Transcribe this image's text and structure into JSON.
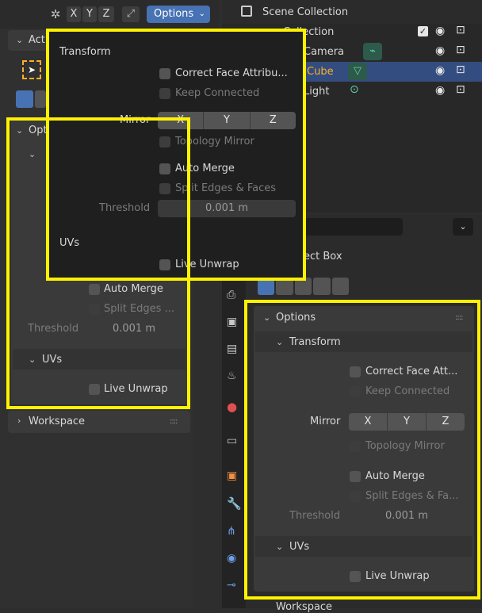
{
  "header": {
    "axis_buttons": [
      "X",
      "Y",
      "Z"
    ],
    "options_label": "Options"
  },
  "outliner": {
    "title": "Scene Collection",
    "rows": [
      {
        "label": "Collection"
      },
      {
        "label": "Camera"
      },
      {
        "label": "Cube"
      },
      {
        "label": "Light"
      }
    ]
  },
  "popup": {
    "transform_heading": "Transform",
    "correct_face": "Correct Face Attribu...",
    "keep_connected": "Keep Connected",
    "mirror_label": "Mirror",
    "mirror_axes": [
      "X",
      "Y",
      "Z"
    ],
    "topology_mirror": "Topology Mirror",
    "auto_merge": "Auto Merge",
    "split_edges": "Split Edges & Faces",
    "threshold_label": "Threshold",
    "threshold_value": "0.001 m",
    "uvs_heading": "UVs",
    "live_unwrap": "Live Unwrap"
  },
  "left_panel": {
    "active_tab": "Acti",
    "options_title": "Opti",
    "auto_merge": "Auto Merge",
    "split_edges": "Split Edges ...",
    "threshold_label": "Threshold",
    "threshold_value": "0.001 m",
    "uvs": "UVs",
    "live_unwrap": "Live Unwrap",
    "workspace": "Workspace"
  },
  "right_panel": {
    "tool_name": "ect Box",
    "options_title": "Options",
    "transform": "Transform",
    "correct_face": "Correct Face Att...",
    "keep_connected": "Keep Connected",
    "mirror_label": "Mirror",
    "mirror_axes": [
      "X",
      "Y",
      "Z"
    ],
    "topology_mirror": "Topology Mirror",
    "auto_merge": "Auto Merge",
    "split_edges": "Split Edges & Fa...",
    "threshold_label": "Threshold",
    "threshold_value": "0.001 m",
    "uvs": "UVs",
    "live_unwrap": "Live Unwrap",
    "workspace": "Workspace"
  },
  "colors": {
    "highlight": "#fff200",
    "selection": "#334d80",
    "accent": "#4772b3"
  }
}
